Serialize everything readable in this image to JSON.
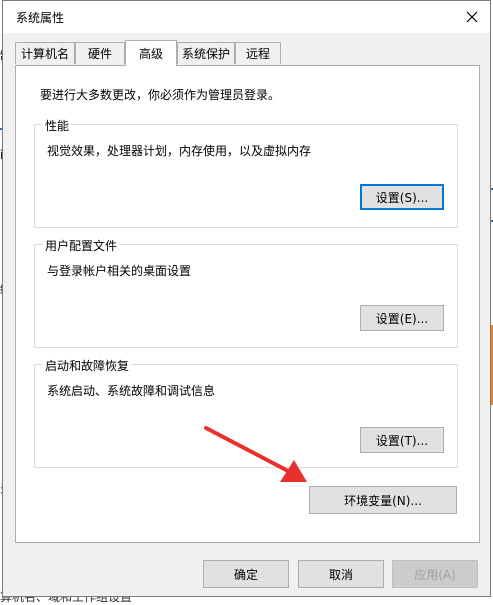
{
  "window": {
    "title": "系统属性"
  },
  "tabs": [
    {
      "label": "计算机名"
    },
    {
      "label": "硬件"
    },
    {
      "label": "高级"
    },
    {
      "label": "系统保护"
    },
    {
      "label": "远程"
    }
  ],
  "admin_note": "要进行大多数更改，你必须作为管理员登录。",
  "groups": {
    "performance": {
      "title": "性能",
      "desc": "视觉效果，处理器计划，内存使用，以及虚拟内存",
      "button": "设置(S)..."
    },
    "profile": {
      "title": "用户配置文件",
      "desc": "与登录帐户相关的桌面设置",
      "button": "设置(E)..."
    },
    "startup": {
      "title": "启动和故障恢复",
      "desc": "系统启动、系统故障和调试信息",
      "button": "设置(T)..."
    }
  },
  "env_button": "环境变量(N)...",
  "footer": {
    "ok": "确定",
    "cancel": "取消",
    "apply": "应用(A)"
  },
  "background": {
    "frag1": "制",
    "frag2": "in",
    "frag3": "终",
    "frag4": "录",
    "bottom": "算机名、域和工作组设置"
  },
  "colors": {
    "accent": "#0078d7",
    "arrow": "#e8312e"
  }
}
